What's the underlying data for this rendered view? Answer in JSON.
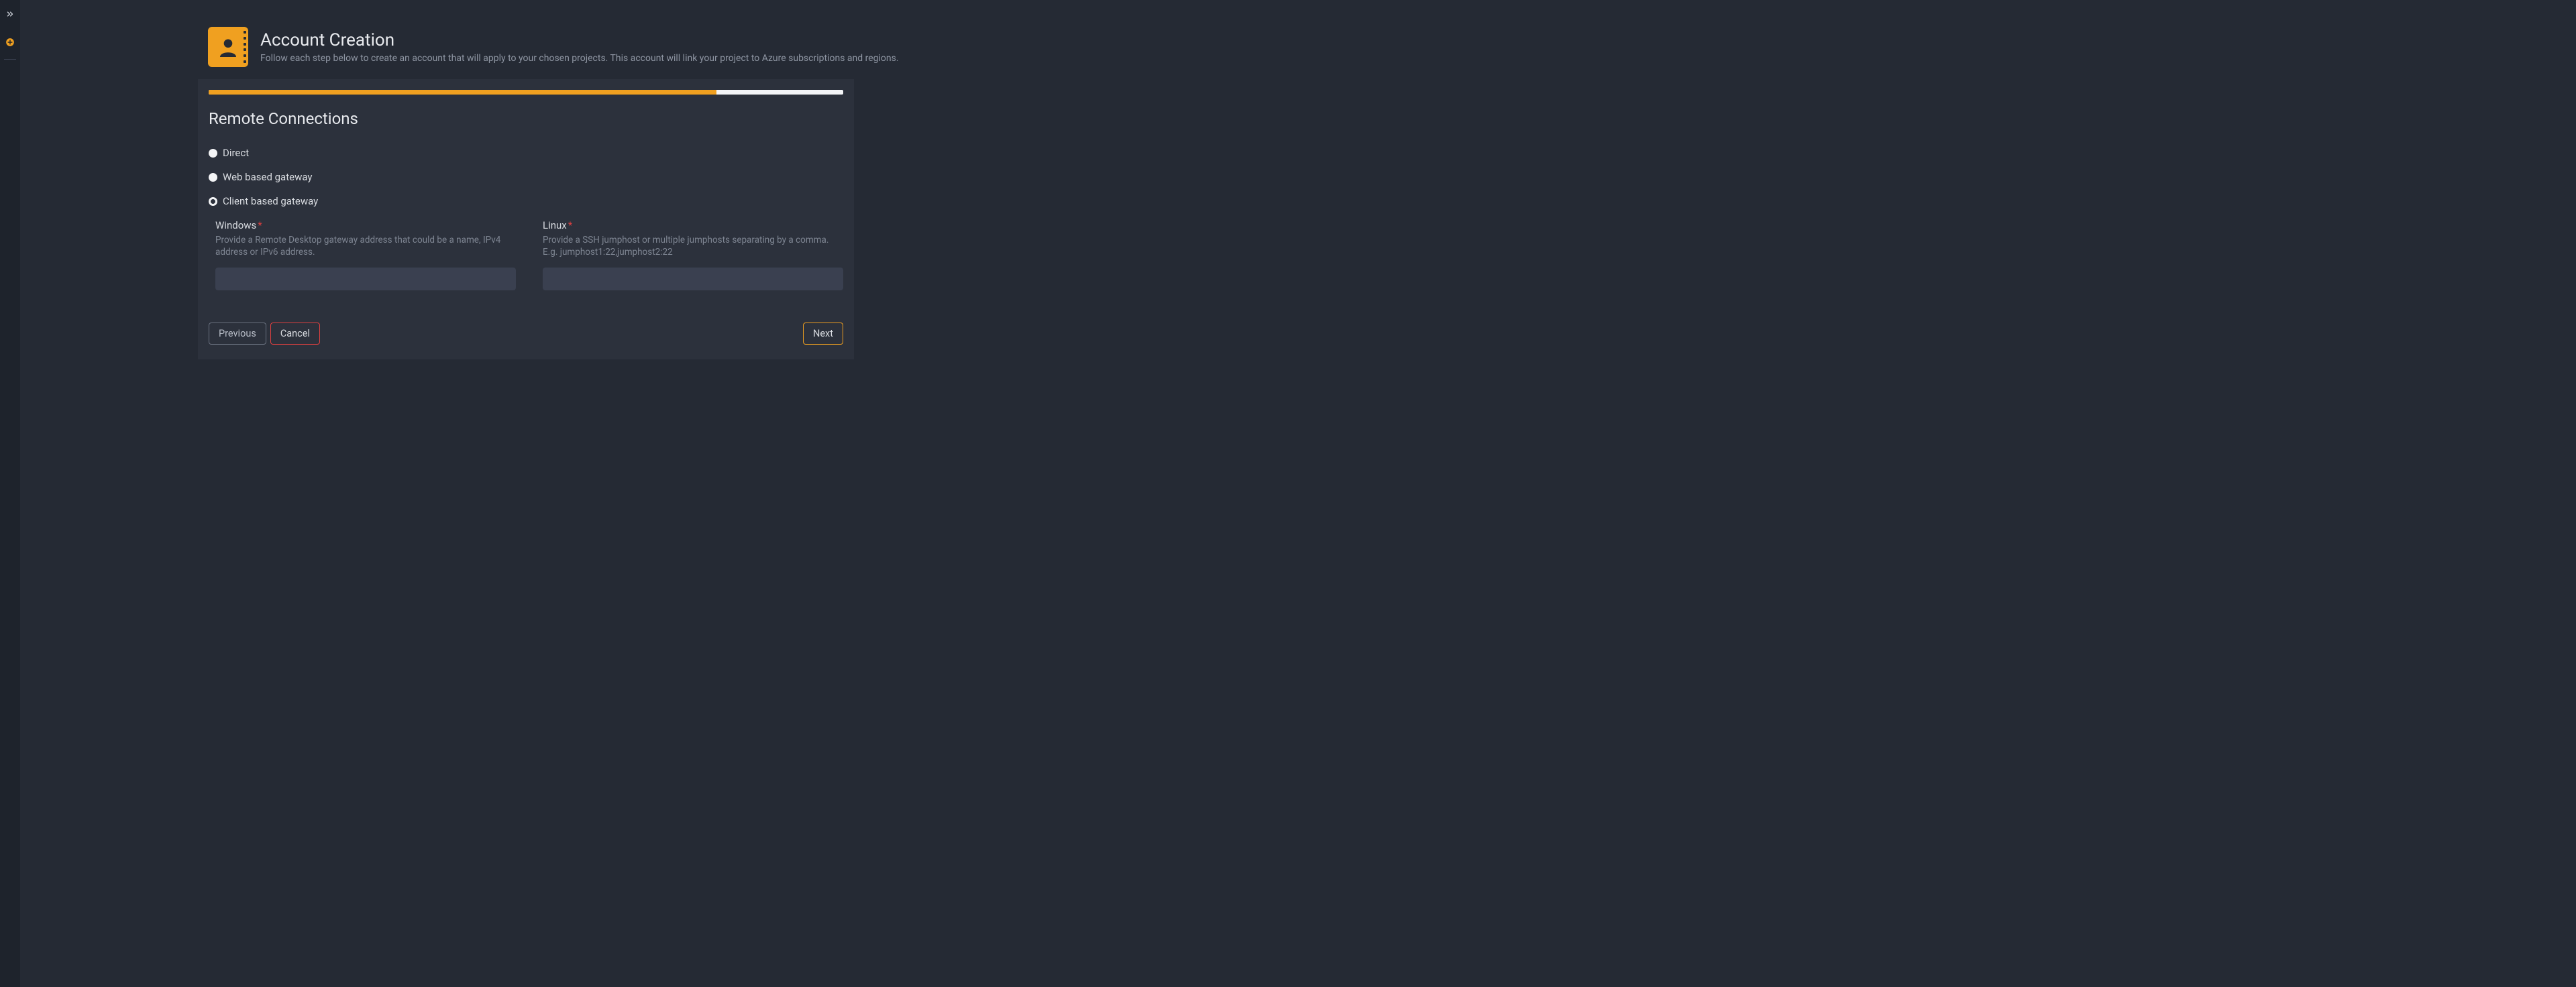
{
  "page": {
    "title": "Account Creation",
    "subtitle": "Follow each step below to create an account that will apply to your chosen projects. This account will link your project to Azure subscriptions and regions."
  },
  "progress": {
    "percent": 80
  },
  "section": {
    "title": "Remote Connections"
  },
  "radios": {
    "direct": "Direct",
    "web_gateway": "Web based gateway",
    "client_gateway": "Client based gateway",
    "selected": "client_gateway"
  },
  "fields": {
    "windows": {
      "label": "Windows",
      "required": "*",
      "help": "Provide a Remote Desktop gateway address that could be a name, IPv4 address or IPv6 address.",
      "value": ""
    },
    "linux": {
      "label": "Linux",
      "required": "*",
      "help": "Provide a SSH jumphost or multiple jumphosts separating by a comma. E.g. jumphost1:22,jumphost2:22",
      "value": ""
    }
  },
  "buttons": {
    "previous": "Previous",
    "cancel": "Cancel",
    "next": "Next"
  }
}
